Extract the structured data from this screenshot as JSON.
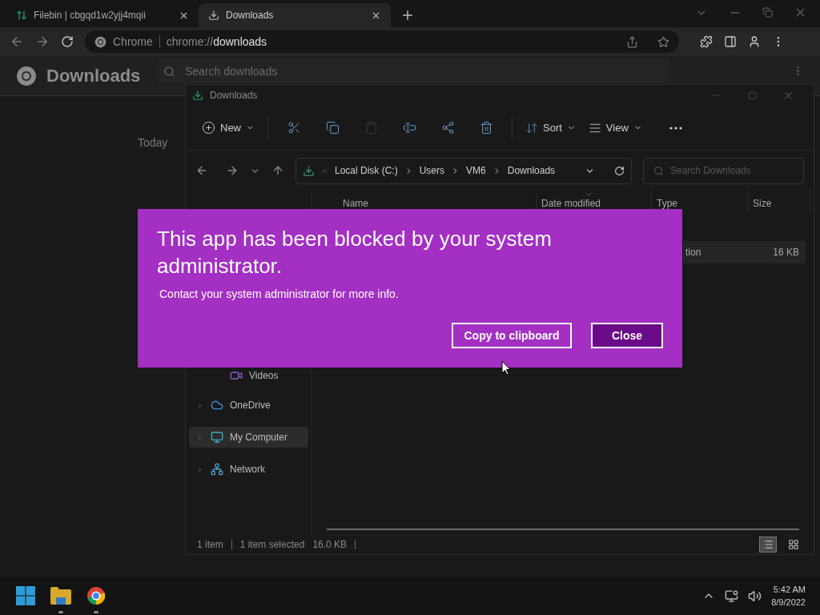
{
  "browser": {
    "tabs": [
      {
        "title": "Filebin | cbgqd1w2yjj4mqii",
        "kind": "filebin",
        "selected": false
      },
      {
        "title": "Downloads",
        "kind": "download",
        "selected": true
      }
    ],
    "omnibox": {
      "chip": "Chrome",
      "scheme": "chrome://",
      "host": "downloads"
    },
    "page": {
      "title": "Downloads",
      "search_placeholder": "Search downloads",
      "date_group": "Today"
    }
  },
  "explorer": {
    "title": "Downloads",
    "toolbar": [
      {
        "kind": "new",
        "label": "New"
      },
      {
        "kind": "cut",
        "disabled": false
      },
      {
        "kind": "copy",
        "disabled": false
      },
      {
        "kind": "paste",
        "disabled": true
      },
      {
        "kind": "rename",
        "disabled": false
      },
      {
        "kind": "share",
        "disabled": false
      },
      {
        "kind": "delete",
        "disabled": false
      },
      {
        "kind": "sort",
        "label": "Sort"
      },
      {
        "kind": "view",
        "label": "View"
      },
      {
        "kind": "more"
      }
    ],
    "breadcrumb": [
      "Local Disk (C:)",
      "Users",
      "VM6",
      "Downloads"
    ],
    "search_placeholder": "Search Downloads",
    "columns": [
      "Name",
      "Date modified",
      "Type",
      "Size"
    ],
    "file": {
      "type": "tion",
      "size": "16 KB",
      "selected": true
    },
    "sidebar": [
      {
        "label": "Videos",
        "kind": "videos",
        "expandable": false,
        "selected": false
      },
      {
        "label": "OneDrive",
        "kind": "cloud",
        "expandable": true,
        "selected": false
      },
      {
        "label": "My Computer",
        "kind": "computer",
        "expandable": true,
        "selected": true
      },
      {
        "label": "Network",
        "kind": "network",
        "expandable": true,
        "selected": false
      }
    ],
    "status": {
      "count": "1 item",
      "selection": "1 item selected",
      "size": "16.0 KB"
    },
    "views": [
      {
        "kind": "details",
        "selected": true
      },
      {
        "kind": "tiles",
        "selected": false
      }
    ]
  },
  "dialog": {
    "title": "This app has been blocked by your system administrator.",
    "message": "Contact your system administrator for more info.",
    "buttons": [
      {
        "label": "Copy to clipboard",
        "kind": "secondary"
      },
      {
        "label": "Close",
        "kind": "primary"
      }
    ]
  },
  "taskbar": {
    "apps": [
      {
        "kind": "start",
        "running": false
      },
      {
        "kind": "explorer",
        "running": true
      },
      {
        "kind": "chrome",
        "running": true
      }
    ],
    "time": "5:42 AM",
    "date": "8/9/2022"
  }
}
